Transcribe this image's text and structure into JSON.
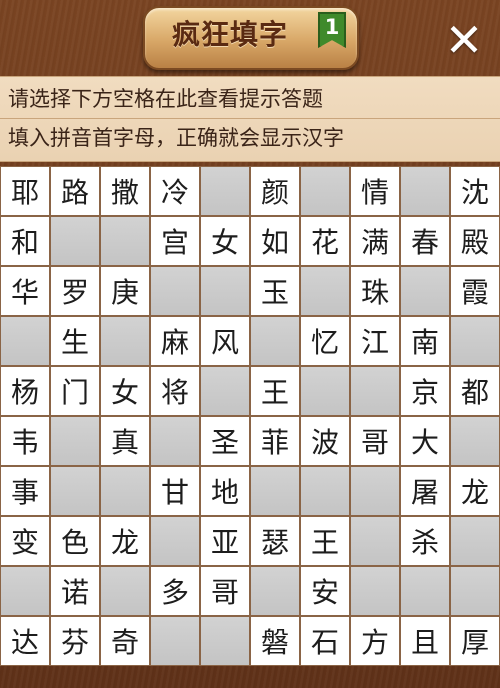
{
  "header": {
    "title": "疯狂填字",
    "level": "1",
    "close_icon": "close-icon"
  },
  "hints": {
    "line1": "请选择下方空格在此查看提示答题",
    "line2": "填入拼音首字母，正确就会显示汉字"
  },
  "colors": {
    "wood": "#6b3a1c",
    "hint_bar": "#ead2b2",
    "filled_cell": "#ffffff",
    "empty_cell": "#c8c8c8",
    "level_badge": "#3f8a2b"
  },
  "grid": {
    "rows": [
      [
        "耶",
        "路",
        "撒",
        "冷",
        "",
        "颜",
        "",
        "情",
        "",
        "沈"
      ],
      [
        "和",
        "",
        "",
        "宫",
        "女",
        "如",
        "花",
        "满",
        "春",
        "殿"
      ],
      [
        "华",
        "罗",
        "庚",
        "",
        "",
        "玉",
        "",
        "珠",
        "",
        "霞"
      ],
      [
        "",
        "生",
        "",
        "麻",
        "风",
        "",
        "忆",
        "江",
        "南",
        ""
      ],
      [
        "杨",
        "门",
        "女",
        "将",
        "",
        "王",
        "",
        "",
        "京",
        "都"
      ],
      [
        "韦",
        "",
        "真",
        "",
        "圣",
        "菲",
        "波",
        "哥",
        "大",
        ""
      ],
      [
        "事",
        "",
        "",
        "甘",
        "地",
        "",
        "",
        "",
        "屠",
        "龙"
      ],
      [
        "变",
        "色",
        "龙",
        "",
        "亚",
        "瑟",
        "王",
        "",
        "杀",
        ""
      ],
      [
        "",
        "诺",
        "",
        "多",
        "哥",
        "",
        "安",
        "",
        "",
        ""
      ],
      [
        "达",
        "芬",
        "奇",
        "",
        "",
        "磐",
        "石",
        "方",
        "且",
        "厚"
      ]
    ]
  }
}
